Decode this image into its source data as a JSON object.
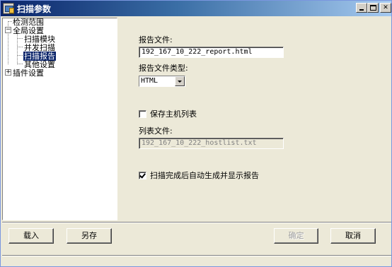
{
  "window": {
    "title": "扫描参数",
    "controls": {
      "minimize": "",
      "maximize": "",
      "close": "✕"
    }
  },
  "tree": {
    "items": [
      {
        "label": "检测范围"
      },
      {
        "label": "全局设置",
        "expander": "−"
      },
      {
        "label": "扫描模块"
      },
      {
        "label": "并发扫描"
      },
      {
        "label": "扫描报告",
        "selected": true
      },
      {
        "label": "其他设置"
      },
      {
        "label": "插件设置",
        "expander": "+"
      }
    ]
  },
  "report": {
    "file_label": "报告文件:",
    "file_value": "192_167_10_222_report.html",
    "type_label": "报告文件类型:",
    "type_value": "HTML",
    "save_hosts_label": "保存主机列表",
    "save_hosts_checked": false,
    "list_file_label": "列表文件:",
    "list_file_value": "192_167_10_222_hostlist.txt",
    "auto_generate_label": "扫描完成后自动生成并显示报告",
    "auto_generate_checked": true
  },
  "buttons": {
    "load": "载入",
    "save_as": "另存",
    "ok": "确定",
    "cancel": "取消"
  }
}
